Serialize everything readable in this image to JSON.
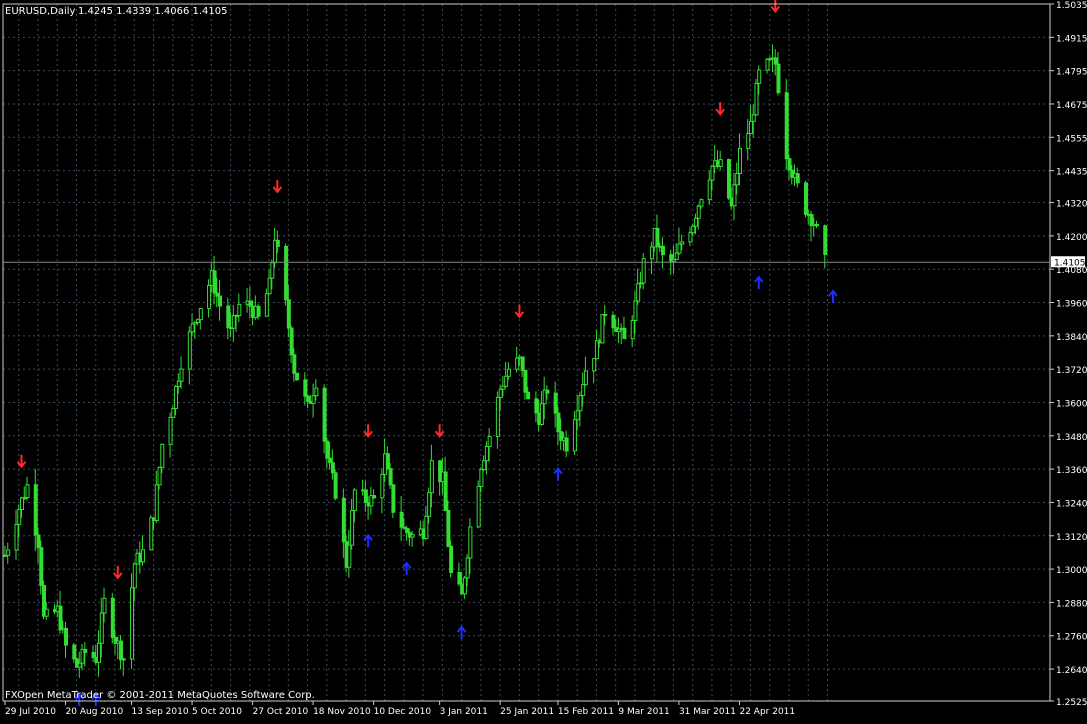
{
  "header": {
    "symbol": "EURUSD,Daily",
    "ohlc": "1.4245 1.4339 1.4066 1.4105"
  },
  "footer": {
    "copyright": "FXOpen MetaTrader © 2001-2011 MetaQuotes Software Corp."
  },
  "colors": {
    "background": "#000000",
    "candle": "#33dd33",
    "grid": "#3a4a5a",
    "axis_text": "#ffffff",
    "down_arrow": "#ff2a2a",
    "up_arrow": "#1e2eff",
    "price_line": "#888888"
  },
  "chart_data": {
    "type": "candlestick",
    "title": "EURUSD,Daily",
    "y_ticks": [
      "1.5035",
      "1.4915",
      "1.4795",
      "1.4675",
      "1.4555",
      "1.4435",
      "1.4320",
      "1.4200",
      "1.4080",
      "1.3960",
      "1.3840",
      "1.3720",
      "1.3600",
      "1.3480",
      "1.3360",
      "1.3240",
      "1.3120",
      "1.3000",
      "1.2880",
      "1.2760",
      "1.2640",
      "1.2525"
    ],
    "x_ticks": [
      "29 Jul 2010",
      "20 Aug 2010",
      "13 Sep 2010",
      "5 Oct 2010",
      "27 Oct 2010",
      "18 Nov 2010",
      "10 Dec 2010",
      "3 Jan 2011",
      "25 Jan 2011",
      "15 Feb 2011",
      "9 Mar 2011",
      "31 Mar 2011",
      "22 Apr 2011"
    ],
    "ylim": [
      1.2525,
      1.5035
    ],
    "current_price": "1.4105",
    "grid": true,
    "close_series": [
      {
        "date": "2010-07-29",
        "value": 1.305
      },
      {
        "date": "2010-08-03",
        "value": 1.322
      },
      {
        "date": "2010-08-06",
        "value": 1.33
      },
      {
        "date": "2010-08-10",
        "value": 1.31
      },
      {
        "date": "2010-08-12",
        "value": 1.282
      },
      {
        "date": "2010-08-17",
        "value": 1.285
      },
      {
        "date": "2010-08-20",
        "value": 1.272
      },
      {
        "date": "2010-08-24",
        "value": 1.265
      },
      {
        "date": "2010-08-27",
        "value": 1.27
      },
      {
        "date": "2010-08-31",
        "value": 1.268
      },
      {
        "date": "2010-09-03",
        "value": 1.288
      },
      {
        "date": "2010-09-07",
        "value": 1.275
      },
      {
        "date": "2010-09-10",
        "value": 1.268
      },
      {
        "date": "2010-09-14",
        "value": 1.302
      },
      {
        "date": "2010-09-17",
        "value": 1.306
      },
      {
        "date": "2010-09-21",
        "value": 1.32
      },
      {
        "date": "2010-09-24",
        "value": 1.345
      },
      {
        "date": "2010-09-28",
        "value": 1.36
      },
      {
        "date": "2010-10-01",
        "value": 1.375
      },
      {
        "date": "2010-10-05",
        "value": 1.387
      },
      {
        "date": "2010-10-08",
        "value": 1.395
      },
      {
        "date": "2010-10-12",
        "value": 1.405
      },
      {
        "date": "2010-10-15",
        "value": 1.395
      },
      {
        "date": "2010-10-19",
        "value": 1.385
      },
      {
        "date": "2010-10-22",
        "value": 1.395
      },
      {
        "date": "2010-10-26",
        "value": 1.395
      },
      {
        "date": "2010-10-29",
        "value": 1.39
      },
      {
        "date": "2010-11-02",
        "value": 1.402
      },
      {
        "date": "2010-11-04",
        "value": 1.42
      },
      {
        "date": "2010-11-08",
        "value": 1.395
      },
      {
        "date": "2010-11-11",
        "value": 1.372
      },
      {
        "date": "2010-11-16",
        "value": 1.358
      },
      {
        "date": "2010-11-19",
        "value": 1.368
      },
      {
        "date": "2010-11-23",
        "value": 1.34
      },
      {
        "date": "2010-11-26",
        "value": 1.328
      },
      {
        "date": "2010-11-30",
        "value": 1.302
      },
      {
        "date": "2010-12-03",
        "value": 1.328
      },
      {
        "date": "2010-12-07",
        "value": 1.325
      },
      {
        "date": "2010-12-10",
        "value": 1.325
      },
      {
        "date": "2010-12-14",
        "value": 1.34
      },
      {
        "date": "2010-12-17",
        "value": 1.322
      },
      {
        "date": "2010-12-21",
        "value": 1.314
      },
      {
        "date": "2010-12-24",
        "value": 1.312
      },
      {
        "date": "2010-12-28",
        "value": 1.314
      },
      {
        "date": "2010-12-31",
        "value": 1.338
      },
      {
        "date": "2011-01-04",
        "value": 1.332
      },
      {
        "date": "2011-01-07",
        "value": 1.298
      },
      {
        "date": "2011-01-11",
        "value": 1.29
      },
      {
        "date": "2011-01-14",
        "value": 1.315
      },
      {
        "date": "2011-01-18",
        "value": 1.338
      },
      {
        "date": "2011-01-21",
        "value": 1.348
      },
      {
        "date": "2011-01-25",
        "value": 1.365
      },
      {
        "date": "2011-01-28",
        "value": 1.372
      },
      {
        "date": "2011-02-01",
        "value": 1.375
      },
      {
        "date": "2011-02-04",
        "value": 1.36
      },
      {
        "date": "2011-02-08",
        "value": 1.355
      },
      {
        "date": "2011-02-11",
        "value": 1.365
      },
      {
        "date": "2011-02-15",
        "value": 1.35
      },
      {
        "date": "2011-02-18",
        "value": 1.345
      },
      {
        "date": "2011-02-22",
        "value": 1.36
      },
      {
        "date": "2011-02-25",
        "value": 1.372
      },
      {
        "date": "2011-03-01",
        "value": 1.38
      },
      {
        "date": "2011-03-04",
        "value": 1.393
      },
      {
        "date": "2011-03-08",
        "value": 1.388
      },
      {
        "date": "2011-03-11",
        "value": 1.382
      },
      {
        "date": "2011-03-15",
        "value": 1.395
      },
      {
        "date": "2011-03-18",
        "value": 1.41
      },
      {
        "date": "2011-03-22",
        "value": 1.42
      },
      {
        "date": "2011-03-25",
        "value": 1.412
      },
      {
        "date": "2011-03-29",
        "value": 1.41
      },
      {
        "date": "2011-04-01",
        "value": 1.418
      },
      {
        "date": "2011-04-05",
        "value": 1.425
      },
      {
        "date": "2011-04-08",
        "value": 1.435
      },
      {
        "date": "2011-04-12",
        "value": 1.445
      },
      {
        "date": "2011-04-15",
        "value": 1.445
      },
      {
        "date": "2011-04-19",
        "value": 1.43
      },
      {
        "date": "2011-04-22",
        "value": 1.45
      },
      {
        "date": "2011-04-26",
        "value": 1.46
      },
      {
        "date": "2011-04-29",
        "value": 1.478
      },
      {
        "date": "2011-05-03",
        "value": 1.482
      },
      {
        "date": "2011-05-05",
        "value": 1.482
      },
      {
        "date": "2011-05-09",
        "value": 1.45
      },
      {
        "date": "2011-05-12",
        "value": 1.44
      },
      {
        "date": "2011-05-16",
        "value": 1.43
      },
      {
        "date": "2011-05-19",
        "value": 1.425
      },
      {
        "date": "2011-05-23",
        "value": 1.4105
      }
    ],
    "down_arrows": [
      {
        "date": "2010-08-04",
        "value": 1.339
      },
      {
        "date": "2010-09-08",
        "value": 1.299
      },
      {
        "date": "2010-11-05",
        "value": 1.438
      },
      {
        "date": "2010-12-08",
        "value": 1.35
      },
      {
        "date": "2011-01-03",
        "value": 1.35
      },
      {
        "date": "2011-02-01",
        "value": 1.393
      },
      {
        "date": "2011-04-15",
        "value": 1.466
      },
      {
        "date": "2011-05-05",
        "value": 1.503
      }
    ],
    "up_arrows": [
      {
        "date": "2010-08-25",
        "value": 1.2528
      },
      {
        "date": "2010-08-31",
        "value": 1.2528
      },
      {
        "date": "2010-12-08",
        "value": 1.31
      },
      {
        "date": "2010-12-22",
        "value": 1.3
      },
      {
        "date": "2011-01-11",
        "value": 1.277
      },
      {
        "date": "2011-02-15",
        "value": 1.334
      },
      {
        "date": "2011-04-29",
        "value": 1.403
      },
      {
        "date": "2011-05-26",
        "value": 1.398
      }
    ]
  }
}
